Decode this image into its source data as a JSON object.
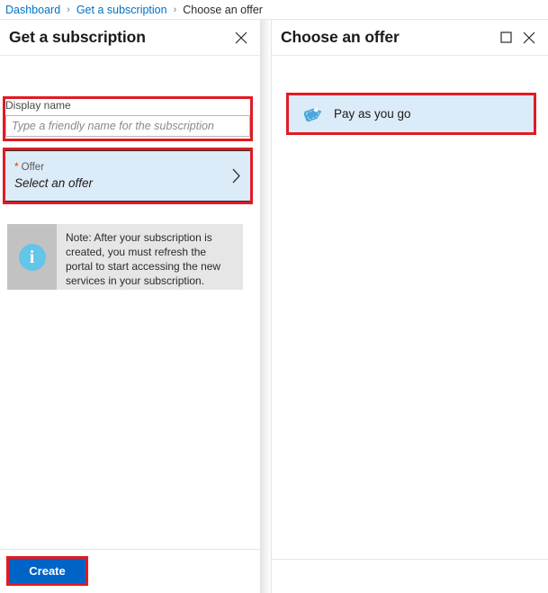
{
  "breadcrumb": {
    "items": [
      {
        "label": "Dashboard",
        "type": "link"
      },
      {
        "label": "Get a subscription",
        "type": "link"
      },
      {
        "label": "Choose an offer",
        "type": "current"
      }
    ],
    "separator": "›"
  },
  "left_panel": {
    "title": "Get a subscription",
    "close_label": "✕",
    "display_name": {
      "label": "Display name",
      "value": "",
      "placeholder": "Type a friendly name for the subscription"
    },
    "offer": {
      "required_marker": "*",
      "label": "Offer",
      "value": "Select an offer",
      "chevron": "›"
    },
    "note": {
      "icon": "i",
      "text": "Note: After your subscription is created, you must refresh the portal to start accessing the new services in your subscription."
    },
    "create_button": {
      "label": "Create",
      "color": "#0063c6"
    }
  },
  "right_panel": {
    "title": "Choose an offer",
    "maximize_label": "□",
    "close_label": "✕",
    "offers": [
      {
        "label": "Pay as you go",
        "icon": "price-tag-icon"
      }
    ]
  },
  "annotations": {
    "color": "#e01b23",
    "regions": [
      "display-name-field",
      "offer-selector",
      "pay-as-you-go-item",
      "create-button"
    ]
  }
}
